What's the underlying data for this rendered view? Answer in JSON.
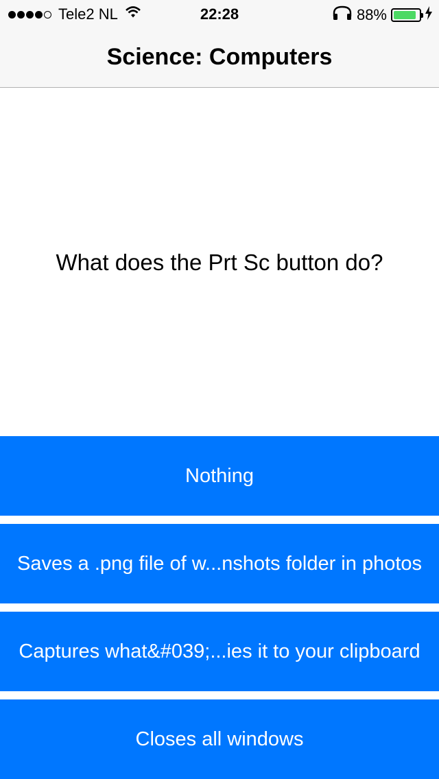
{
  "status_bar": {
    "carrier": "Tele2 NL",
    "time": "22:28",
    "battery_percent": "88%",
    "battery_level": 0.88,
    "signal_bars_filled": 4,
    "signal_bars_total": 5,
    "icons": [
      "wifi-icon",
      "headphones-icon",
      "battery-icon",
      "charging-bolt-icon"
    ],
    "battery_color": "#4cd964"
  },
  "nav": {
    "title": "Science: Computers"
  },
  "question": {
    "text": "What does the Prt Sc button do?"
  },
  "answers": [
    {
      "label": "Nothing"
    },
    {
      "label": "Saves a .png file of w...nshots folder in photos"
    },
    {
      "label": "Captures what&#039;...ies it to your clipboard"
    },
    {
      "label": "Closes all windows"
    }
  ],
  "colors": {
    "answer_background": "#0077ff",
    "answer_text": "#ffffff",
    "nav_background": "#f7f7f7"
  }
}
